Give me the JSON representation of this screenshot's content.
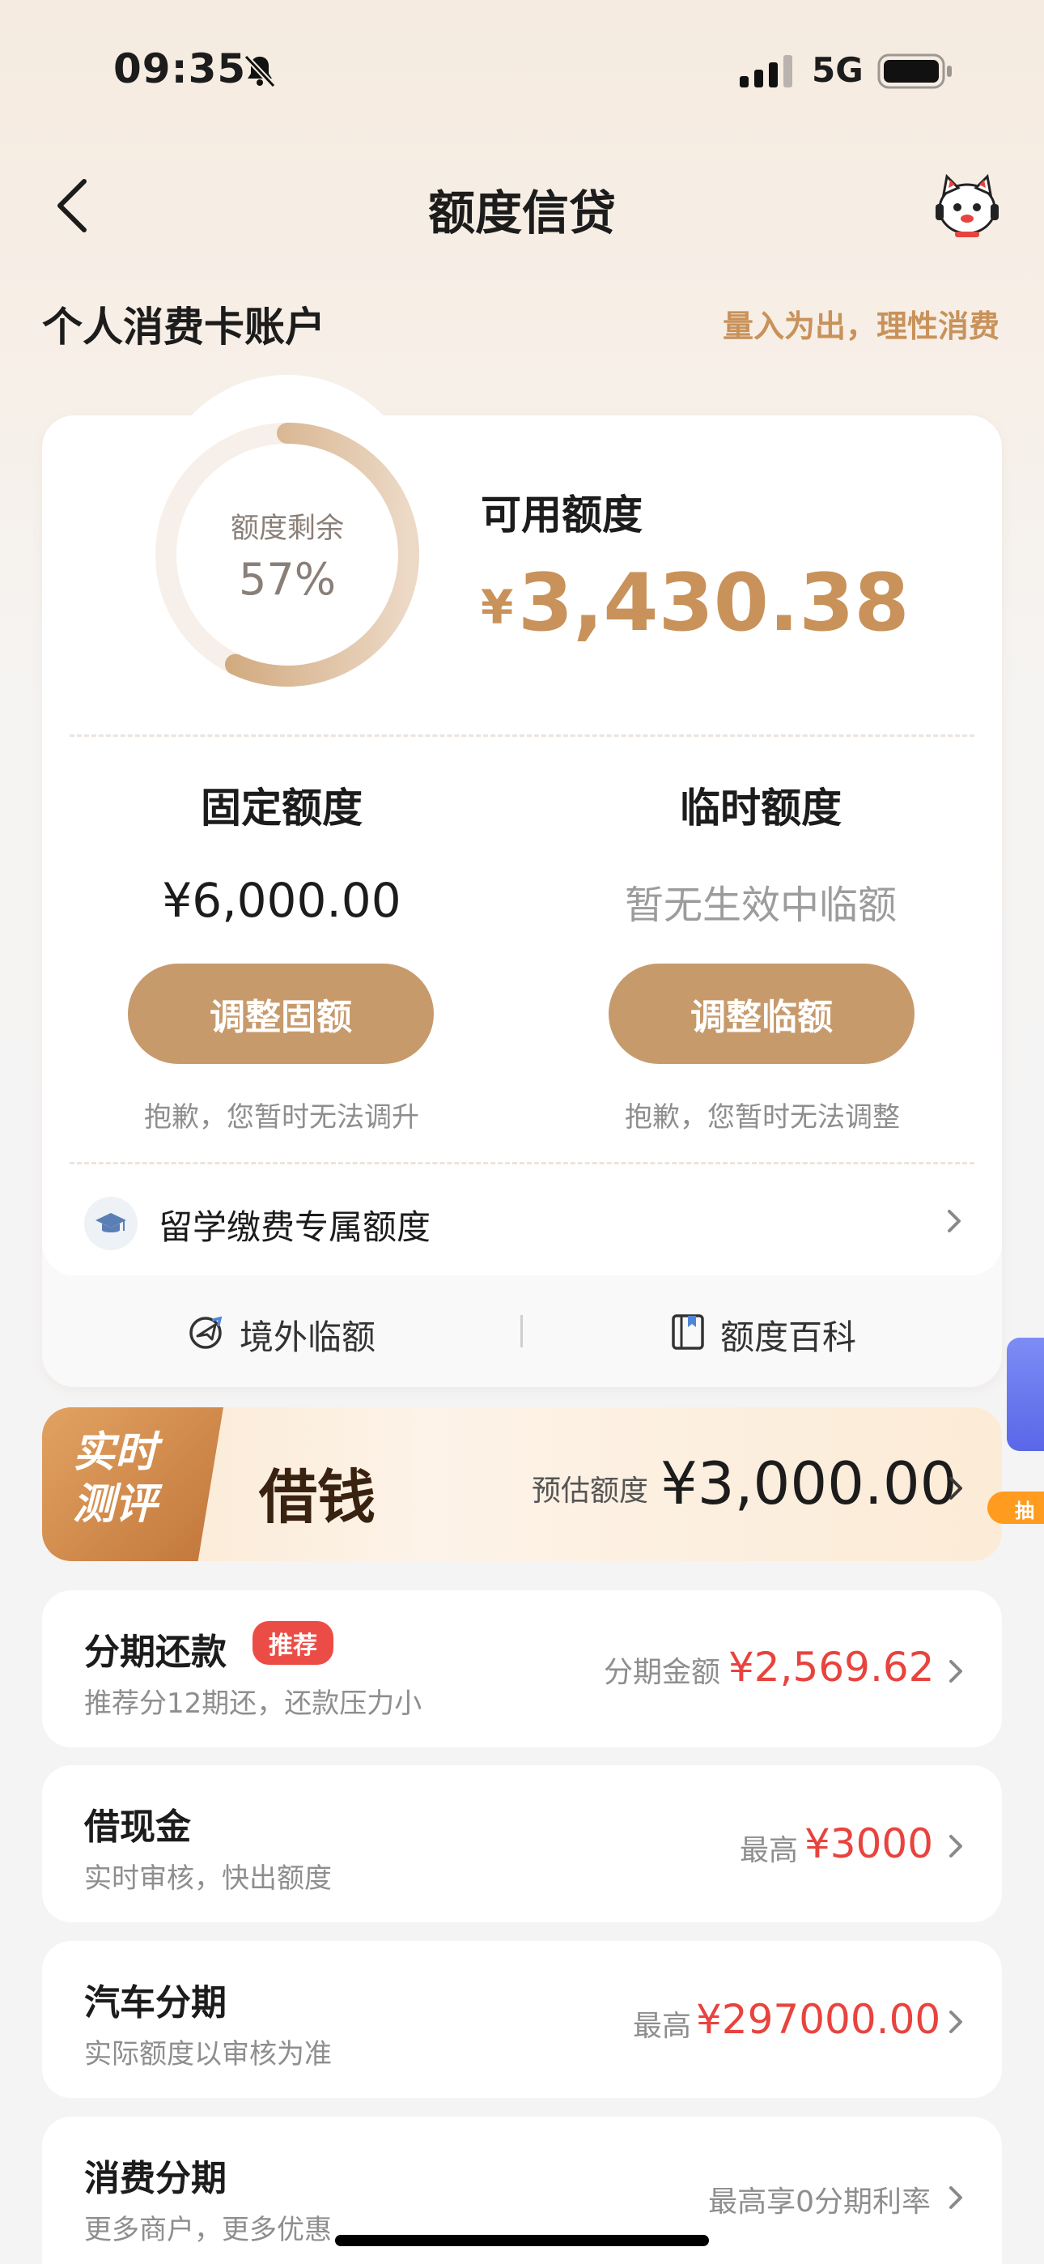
{
  "status_bar": {
    "time": "09:35",
    "network": "5G",
    "icons": [
      "bell-off-icon",
      "signal-icon",
      "battery-icon"
    ]
  },
  "nav": {
    "title": "额度信贷",
    "back_icon": "chevron-left-icon",
    "mascot_icon": "mascot-icon"
  },
  "account": {
    "title": "个人消费卡账户",
    "slogan": "量入为出，理性消费"
  },
  "quota": {
    "ring_label": "额度剩余",
    "remaining_percent": "57%",
    "remaining_fraction": 0.57,
    "available_label": "可用额度",
    "currency": "¥",
    "available_amount": "3,430.38"
  },
  "fixed": {
    "label": "固定额度",
    "value": "¥6,000.00",
    "button": "调整固额",
    "note": "抱歉，您暂时无法调升"
  },
  "temporary": {
    "label": "临时额度",
    "value": "暂无生效中临额",
    "button": "调整临额",
    "note": "抱歉，您暂时无法调整"
  },
  "study_abroad": {
    "label": "留学缴费专属额度",
    "icon": "graduation-cap-icon"
  },
  "footer_links": [
    {
      "label": "境外临额",
      "icon": "globe-plane-icon"
    },
    {
      "label": "额度百科",
      "icon": "book-icon"
    }
  ],
  "loan_banner": {
    "tag_line1": "实时",
    "tag_line2": "测评",
    "title": "借钱",
    "estimate_label": "预估额度",
    "estimate_amount": "¥3,000.00"
  },
  "side_widget": {
    "label": "抽"
  },
  "items": [
    {
      "title": "分期还款",
      "badge": "推荐",
      "subtitle": "推荐分12期还，还款压力小",
      "prefix": "分期金额",
      "amount": "¥2,569.62"
    },
    {
      "title": "借现金",
      "subtitle": "实时审核，快出额度",
      "prefix": "最高",
      "amount": "¥3000"
    },
    {
      "title": "汽车分期",
      "subtitle": "实际额度以审核为准",
      "prefix": "最高",
      "amount": "¥297000.00"
    },
    {
      "title": "消费分期",
      "subtitle": "更多商户，更多优惠",
      "prefix": "最高享0分期利率",
      "amount": ""
    }
  ],
  "colors": {
    "gold": "#c79a6c",
    "gold_text": "#c8925a",
    "red": "#e8433e",
    "badge": "#eb4d46"
  }
}
